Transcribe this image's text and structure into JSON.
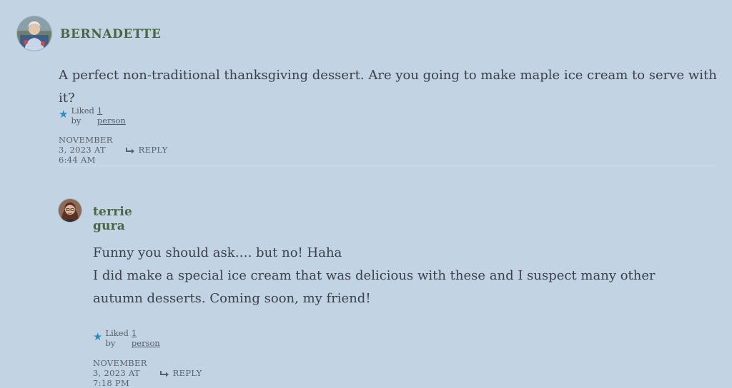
{
  "comments": [
    {
      "author": "BERNADETTE",
      "avatar": "user-photo-bernadette",
      "text": [
        "A perfect non-traditional thanksgiving dessert. Are you going to make maple ice cream to serve with it?"
      ],
      "likes_prefix": "Liked by",
      "likes_link": "1 person",
      "date": "NOVEMBER 3, 2023 AT 6:44 AM",
      "reply_label": "REPLY"
    },
    {
      "author": "terrie gura",
      "avatar": "user-photo-terrie-gura",
      "text": [
        "Funny you should ask…. but no! Haha",
        "I did make a special ice cream that was delicious with these and I suspect many other autumn desserts. Coming soon, my friend!"
      ],
      "likes_prefix": "Liked by",
      "likes_link": "1 person",
      "date": "NOVEMBER 3, 2023 AT 7:18 PM",
      "reply_label": "REPLY"
    }
  ],
  "colors": {
    "background": "#c2d4e3",
    "author": "#4a6741",
    "text": "#3b3f47",
    "like_star": "#2a8cc0"
  },
  "icons": {
    "like": "star-icon",
    "reply": "reply-arrow-icon"
  }
}
